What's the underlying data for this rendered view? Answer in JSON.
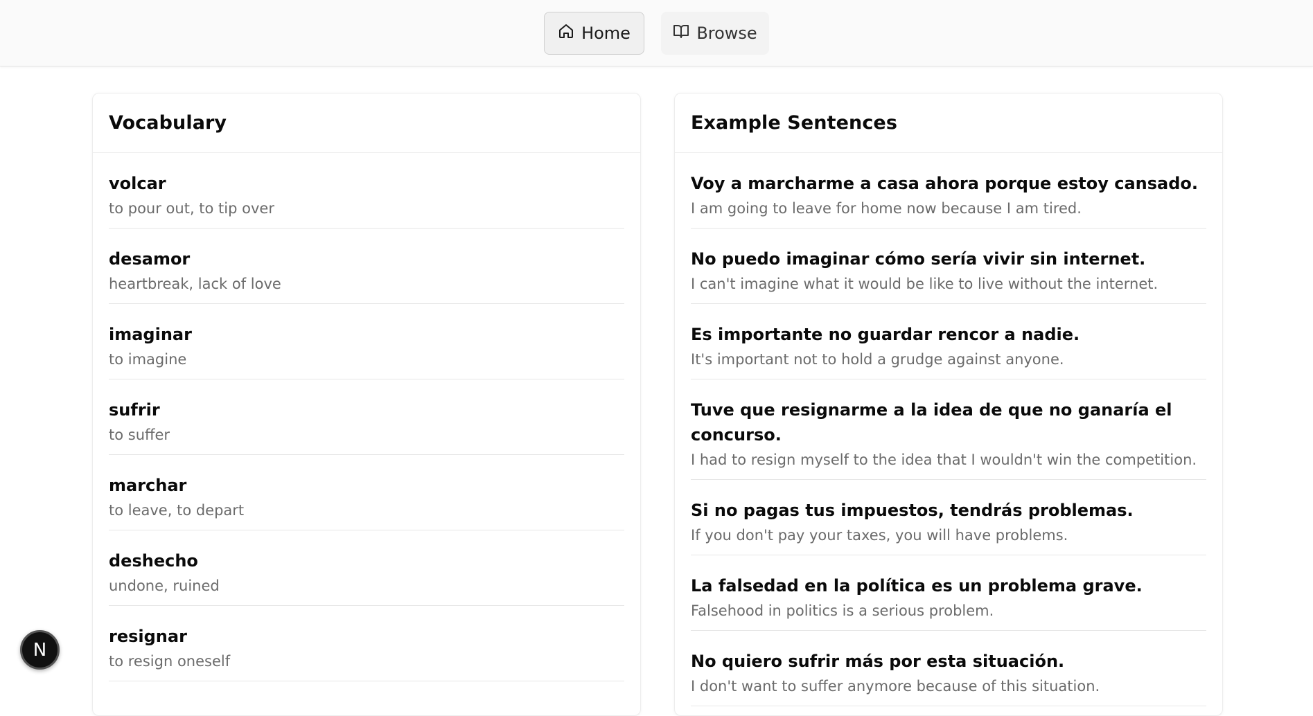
{
  "nav": {
    "home_label": "Home",
    "home_icon": "home-icon",
    "browse_label": "Browse",
    "browse_icon": "open-book-icon"
  },
  "vocabulary": {
    "title": "Vocabulary",
    "items": [
      {
        "term": "volcar",
        "meaning": "to pour out, to tip over"
      },
      {
        "term": "desamor",
        "meaning": "heartbreak, lack of love"
      },
      {
        "term": "imaginar",
        "meaning": "to imagine"
      },
      {
        "term": "sufrir",
        "meaning": "to suffer"
      },
      {
        "term": "marchar",
        "meaning": "to leave, to depart"
      },
      {
        "term": "deshecho",
        "meaning": "undone, ruined"
      },
      {
        "term": "resignar",
        "meaning": "to resign oneself"
      }
    ]
  },
  "examples": {
    "title": "Example Sentences",
    "items": [
      {
        "sentence": "Voy a marcharme a casa ahora porque estoy cansado.",
        "translation": "I am going to leave for home now because I am tired."
      },
      {
        "sentence": "No puedo imaginar cómo sería vivir sin internet.",
        "translation": "I can't imagine what it would be like to live without the internet."
      },
      {
        "sentence": "Es importante no guardar rencor a nadie.",
        "translation": "It's important not to hold a grudge against anyone."
      },
      {
        "sentence": "Tuve que resignarme a la idea de que no ganaría el concurso.",
        "translation": "I had to resign myself to the idea that I wouldn't win the competition."
      },
      {
        "sentence": "Si no pagas tus impuestos, tendrás problemas.",
        "translation": "If you don't pay your taxes, you will have problems."
      },
      {
        "sentence": "La falsedad en la política es un problema grave.",
        "translation": "Falsehood in politics is a serious problem."
      },
      {
        "sentence": "No quiero sufrir más por esta situación.",
        "translation": "I don't want to suffer anymore because of this situation."
      }
    ]
  },
  "badge": {
    "letter": "N"
  }
}
